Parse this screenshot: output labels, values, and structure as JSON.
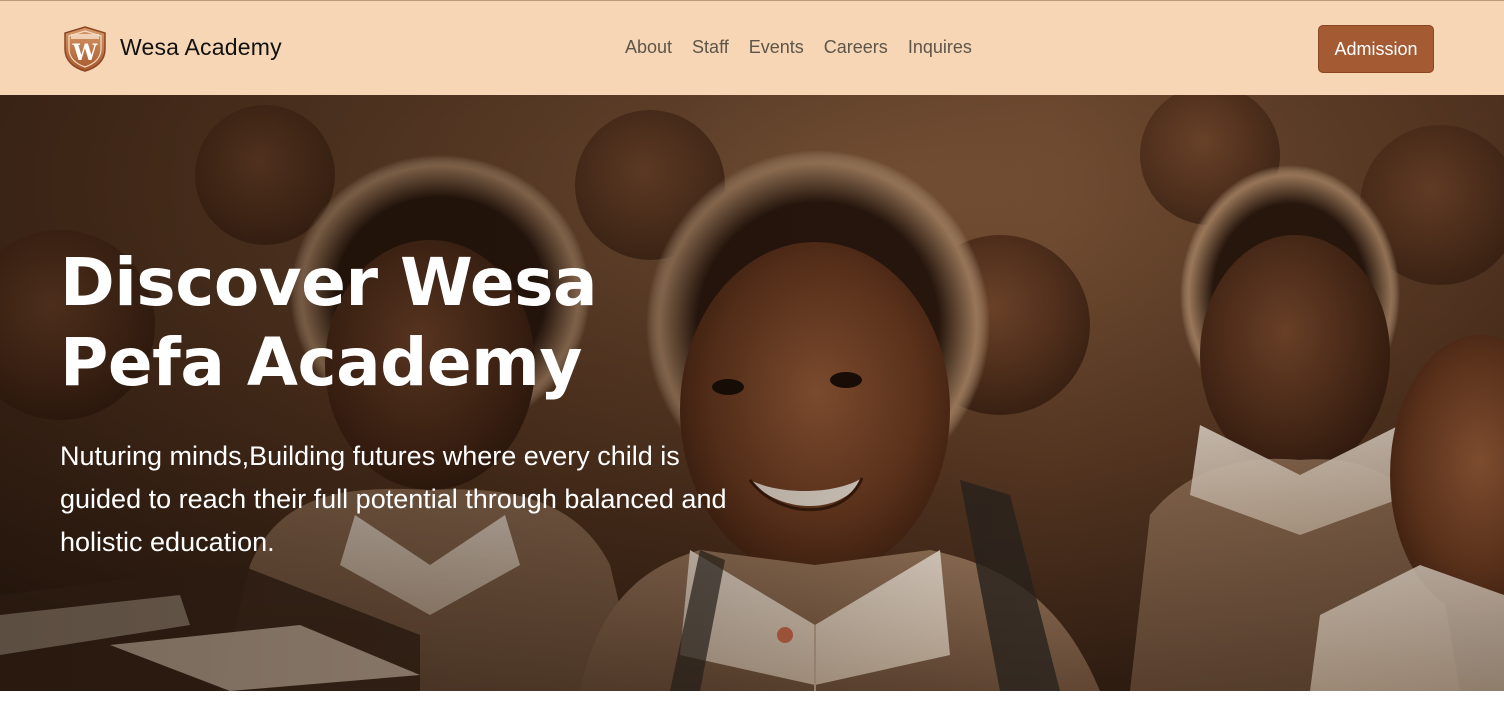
{
  "header": {
    "brand_name": "Wesa Academy",
    "logo_letter": "W",
    "nav": [
      {
        "label": "About"
      },
      {
        "label": "Staff"
      },
      {
        "label": "Events"
      },
      {
        "label": "Careers"
      },
      {
        "label": "Inquires"
      }
    ],
    "cta_label": "Admission"
  },
  "hero": {
    "title": "Discover Wesa Pefa Academy",
    "subtitle": "Nuturing minds,Building futures where every child is guided to reach their full potential through balanced and holistic education."
  },
  "colors": {
    "header_bg": "#f6d6b5",
    "accent": "#a45a32",
    "nav_text": "#5e5549"
  }
}
